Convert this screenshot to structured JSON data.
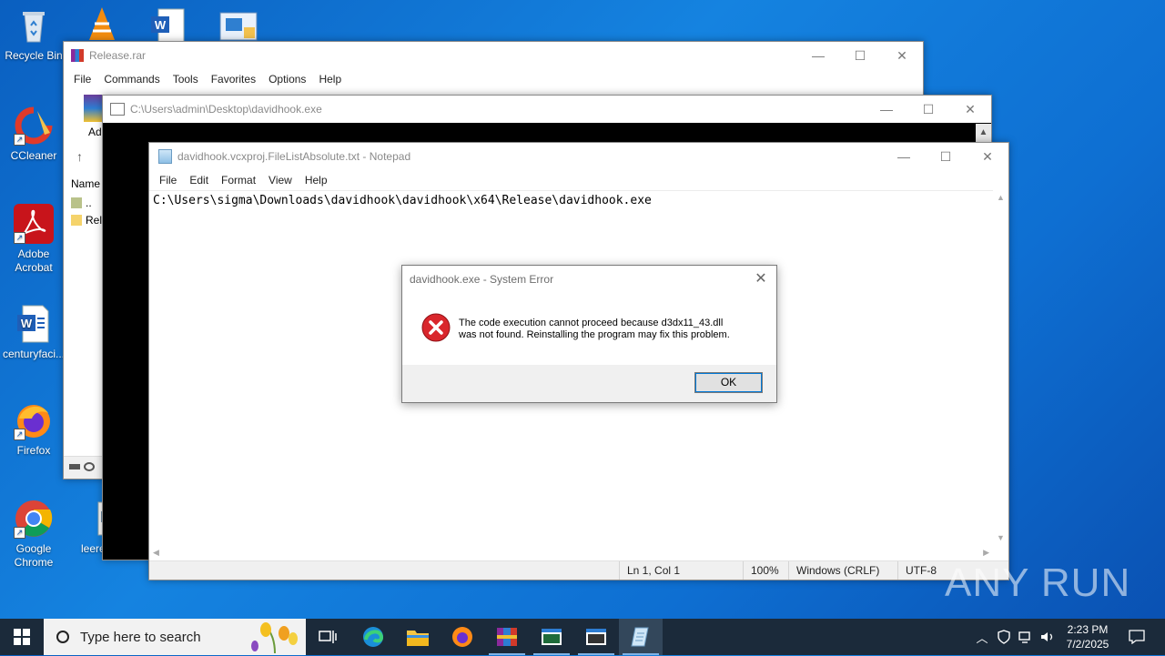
{
  "desktop": {
    "icons": [
      {
        "label": "Recycle Bin"
      },
      {
        "label": "CCleaner"
      },
      {
        "label": "Adobe Acrobat"
      },
      {
        "label": "centuryfaci..."
      },
      {
        "label": "Firefox"
      },
      {
        "label": "Google Chrome"
      },
      {
        "label": "leere"
      }
    ]
  },
  "winrar": {
    "title": "Release.rar",
    "menu": [
      "File",
      "Commands",
      "Tools",
      "Favorites",
      "Options",
      "Help"
    ],
    "toolbar_partial_label": "Ad",
    "column_name": "Name",
    "rows": [
      "..",
      "Rele"
    ]
  },
  "console": {
    "title": "C:\\Users\\admin\\Desktop\\davidhook.exe"
  },
  "notepad": {
    "title": "davidhook.vcxproj.FileListAbsolute.txt - Notepad",
    "menu": [
      "File",
      "Edit",
      "Format",
      "View",
      "Help"
    ],
    "content": "C:\\Users\\sigma\\Downloads\\davidhook\\davidhook\\x64\\Release\\davidhook.exe",
    "status": {
      "position": "Ln 1, Col 1",
      "zoom": "100%",
      "line_ending": "Windows (CRLF)",
      "encoding": "UTF-8"
    }
  },
  "dialog": {
    "title": "davidhook.exe - System Error",
    "message_line1": "The code execution cannot proceed because d3dx11_43.dll",
    "message_line2": "was not found. Reinstalling the program may fix this problem.",
    "ok_label": "OK",
    "icon": "error-icon"
  },
  "taskbar": {
    "search_placeholder": "Type here to search",
    "time": "2:23 PM",
    "date": "7/2/2025"
  },
  "watermark": "ANY RUN",
  "colors": {
    "desktop_blue": "#1583e0",
    "taskbar": "#1b2a3a",
    "error_red": "#d9262c",
    "focus_blue": "#0078d7"
  }
}
